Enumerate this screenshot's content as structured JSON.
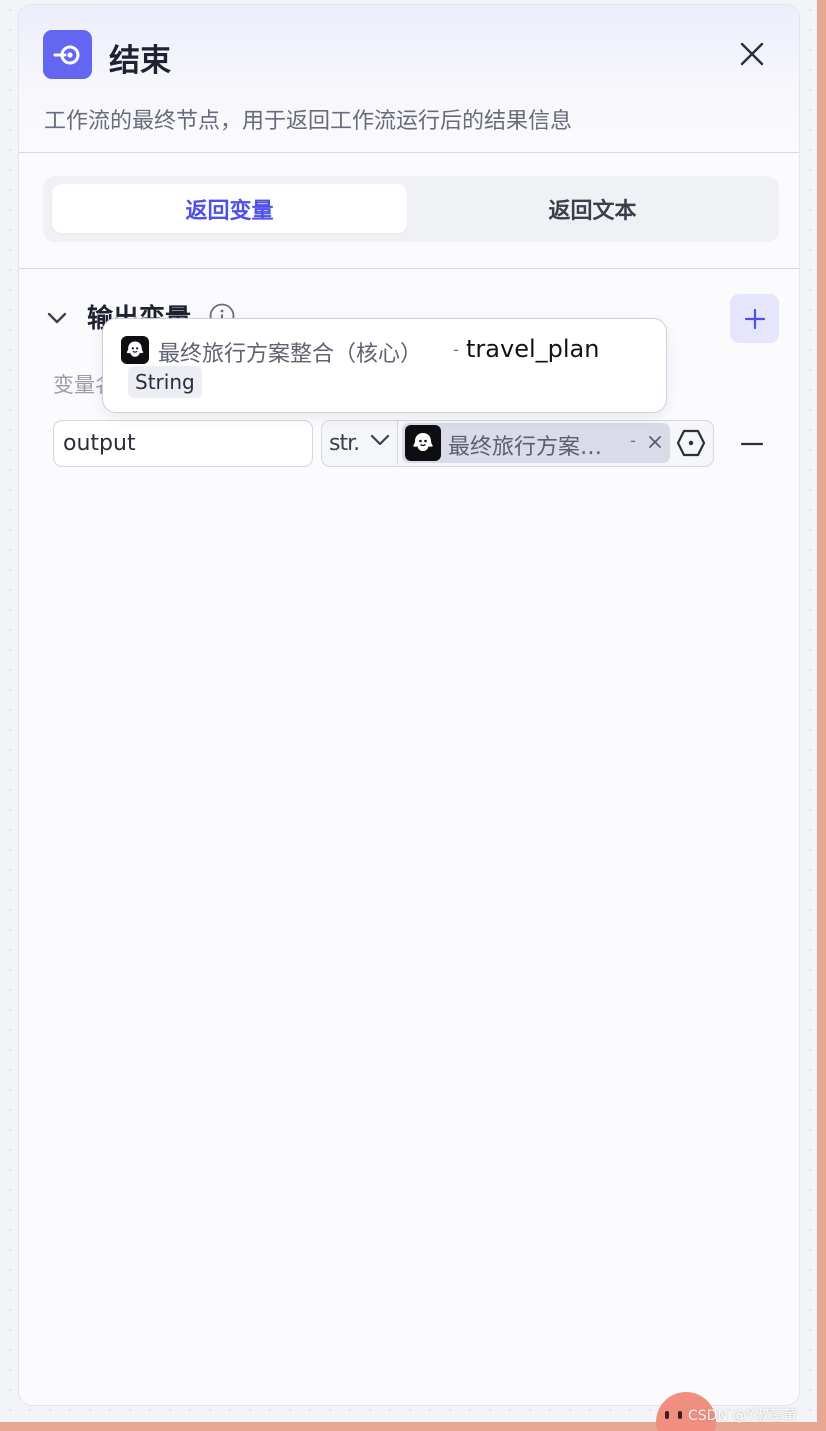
{
  "panel": {
    "title": "结束",
    "description": "工作流的最终节点，用于返回工作流运行后的结果信息",
    "accent_color": "#6366f1"
  },
  "tabs": [
    {
      "label": "返回变量",
      "active": true
    },
    {
      "label": "返回文本",
      "active": false
    }
  ],
  "output_section": {
    "title": "输出变量",
    "column_label": "变量名",
    "rows": [
      {
        "name": "output",
        "type": "str.",
        "reference": {
          "node": "最终旅行方案…",
          "separator": "-"
        }
      }
    ]
  },
  "tooltip": {
    "node": "最终旅行方案整合（核心）",
    "separator": "-",
    "variable": "travel_plan",
    "type": "String"
  },
  "watermark": "CSDN @Y淑蓬莆"
}
